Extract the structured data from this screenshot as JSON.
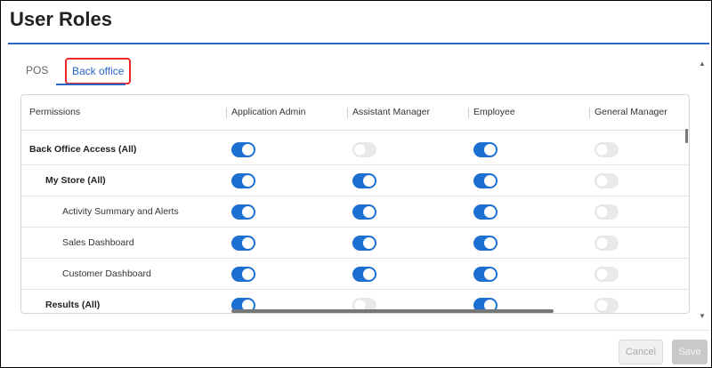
{
  "page": {
    "title": "User Roles"
  },
  "tabs": [
    {
      "label": "POS",
      "active": false
    },
    {
      "label": "Back office",
      "active": true
    }
  ],
  "colors": {
    "accent": "#2a64c5",
    "toggle_on": "#1d6fd1",
    "toggle_off": "#e9e9e9",
    "highlight": "#e8292c"
  },
  "table": {
    "columns": [
      "Permissions",
      "Application Admin",
      "Assistant Manager",
      "Employee",
      "General Manager"
    ],
    "rows": [
      {
        "label": "Back Office Access (All)",
        "bold": true,
        "level": 0,
        "states": [
          true,
          false,
          true,
          false
        ]
      },
      {
        "label": "My Store (All)",
        "bold": true,
        "level": 1,
        "states": [
          true,
          true,
          true,
          false
        ]
      },
      {
        "label": "Activity Summary and Alerts",
        "bold": false,
        "level": 2,
        "states": [
          true,
          true,
          true,
          false
        ]
      },
      {
        "label": "Sales Dashboard",
        "bold": false,
        "level": 2,
        "states": [
          true,
          true,
          true,
          false
        ]
      },
      {
        "label": "Customer Dashboard",
        "bold": false,
        "level": 2,
        "states": [
          true,
          true,
          true,
          false
        ]
      },
      {
        "label": "Results (All)",
        "bold": true,
        "level": 1,
        "states": [
          true,
          false,
          true,
          false
        ]
      }
    ]
  },
  "footer": {
    "cancel_label": "Cancel",
    "save_label": "Save"
  },
  "icons": {
    "scroll_up": "triangle-up-icon",
    "scroll_down": "triangle-down-icon"
  }
}
